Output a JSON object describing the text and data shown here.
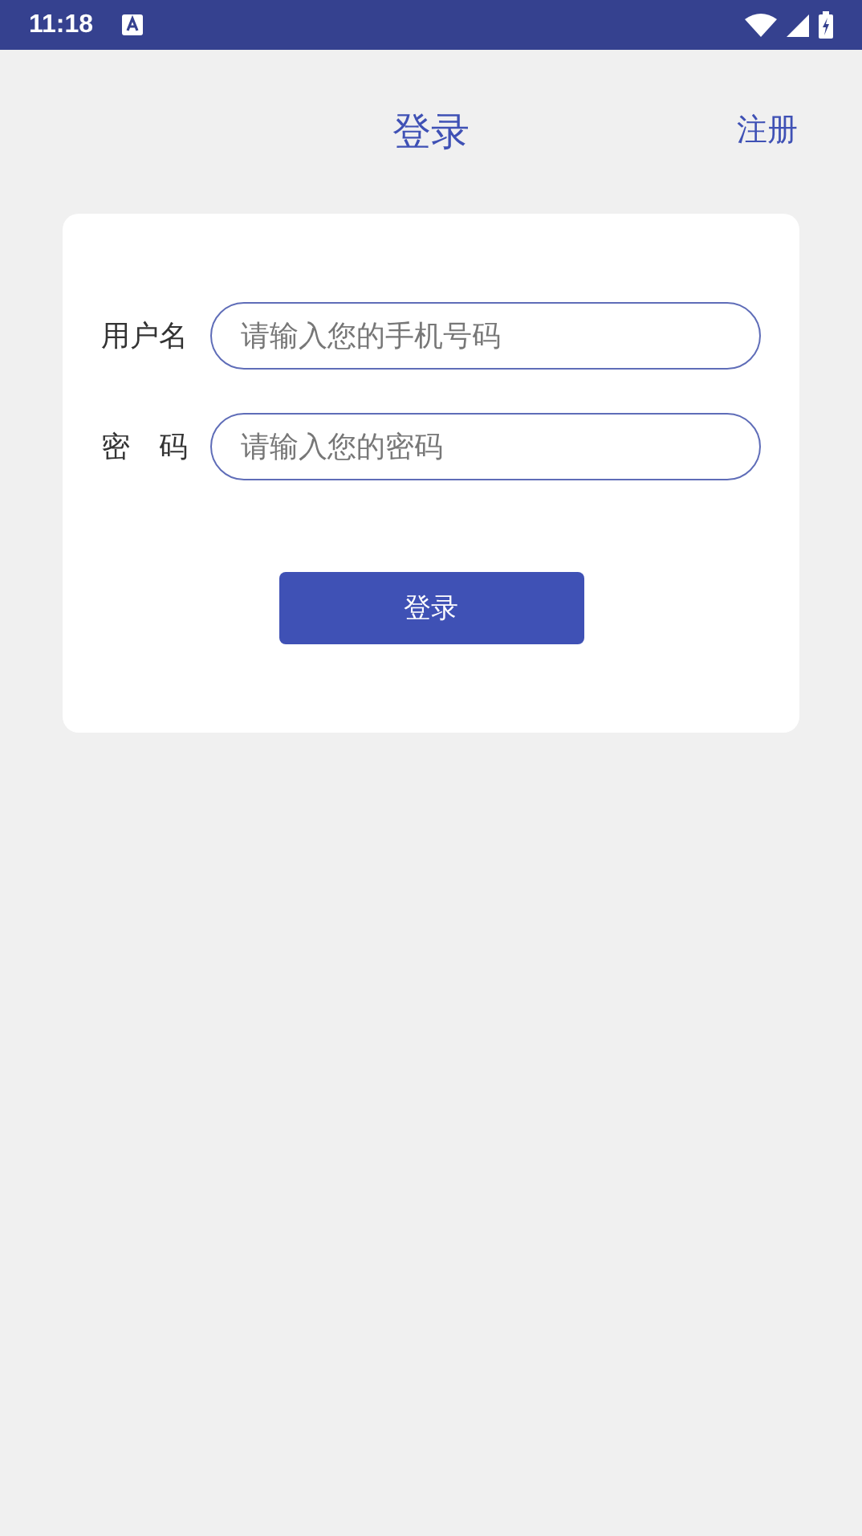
{
  "status_bar": {
    "time": "11:18"
  },
  "header": {
    "title": "登录",
    "action": "注册"
  },
  "form": {
    "fields": [
      {
        "label": "用户名",
        "placeholder": "请输入您的手机号码"
      },
      {
        "label": "密　码",
        "placeholder": "请输入您的密码"
      }
    ],
    "submit": "登录"
  }
}
